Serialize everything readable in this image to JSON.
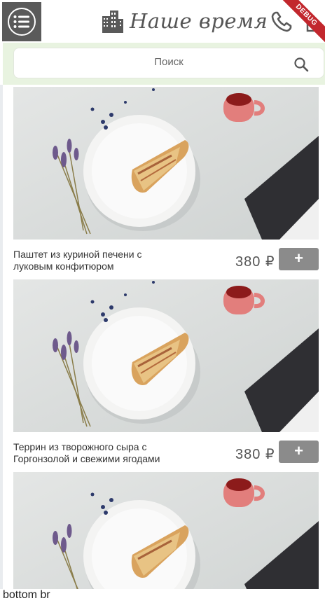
{
  "header": {
    "logo_text": "Наше время",
    "debug_label": "DEBUG"
  },
  "search": {
    "placeholder": "Поиск"
  },
  "products": [
    {
      "name": "Паштет из куриной печени с луковым конфитюром",
      "price": "380 ₽",
      "add_label": "+"
    },
    {
      "name": "Террин из творожного сыра с Горгонзолой и свежими ягодами",
      "price": "380 ₽",
      "add_label": "+"
    },
    {
      "name": "",
      "price": "",
      "add_label": ""
    }
  ],
  "footer": {
    "text": "bottom br"
  }
}
